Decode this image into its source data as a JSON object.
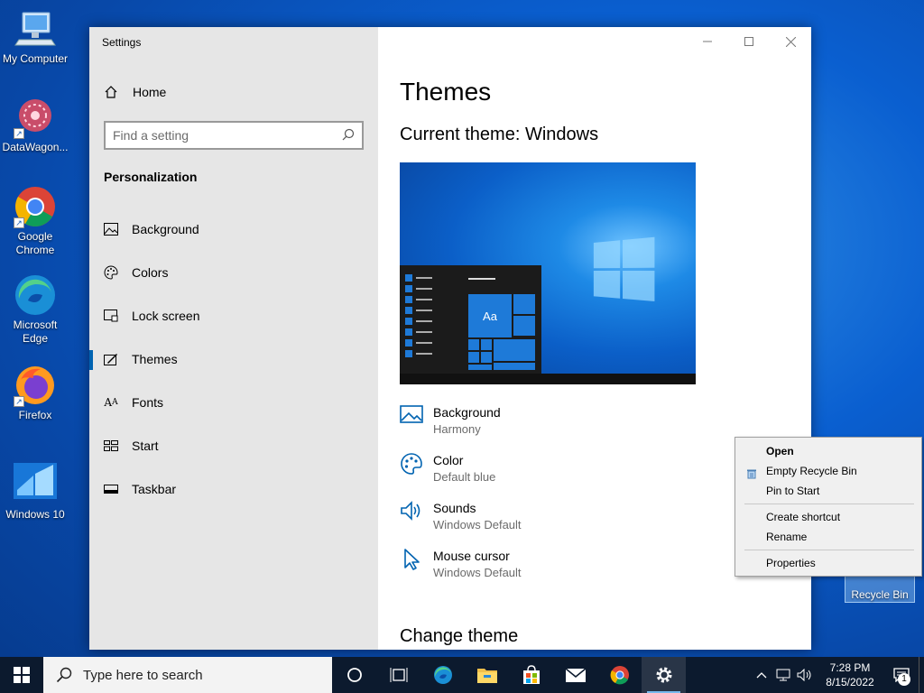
{
  "desktop": {
    "icons": [
      {
        "label": "My Computer"
      },
      {
        "label": "DataWagon..."
      },
      {
        "label": "Google Chrome"
      },
      {
        "label": "Microsoft Edge"
      },
      {
        "label": "Firefox"
      },
      {
        "label": "Windows 10"
      }
    ],
    "recycle_bin": {
      "label": "Recycle Bin"
    }
  },
  "settings": {
    "title": "Settings",
    "home_label": "Home",
    "search_placeholder": "Find a setting",
    "section_title": "Personalization",
    "nav_items": [
      {
        "label": "Background",
        "icon": "image-icon"
      },
      {
        "label": "Colors",
        "icon": "palette-icon"
      },
      {
        "label": "Lock screen",
        "icon": "lock-screen-icon"
      },
      {
        "label": "Themes",
        "icon": "themes-icon",
        "active": true
      },
      {
        "label": "Fonts",
        "icon": "fonts-icon"
      },
      {
        "label": "Start",
        "icon": "start-icon"
      },
      {
        "label": "Taskbar",
        "icon": "taskbar-icon"
      }
    ],
    "page_title": "Themes",
    "current_theme": "Current theme: Windows",
    "preview_tile_text": "Aa",
    "properties": [
      {
        "label": "Background",
        "value": "Harmony",
        "icon": "picture-icon"
      },
      {
        "label": "Color",
        "value": "Default blue",
        "icon": "palette-icon"
      },
      {
        "label": "Sounds",
        "value": "Windows Default",
        "icon": "speaker-icon"
      },
      {
        "label": "Mouse cursor",
        "value": "Windows Default",
        "icon": "cursor-icon"
      }
    ],
    "change_theme": "Change theme"
  },
  "context_menu": {
    "items": [
      {
        "label": "Open",
        "bold": true
      },
      {
        "label": "Empty Recycle Bin",
        "icon": "recycle-bin-icon"
      },
      {
        "label": "Pin to Start"
      },
      {
        "separator": true
      },
      {
        "label": "Create shortcut"
      },
      {
        "label": "Rename"
      },
      {
        "separator": true
      },
      {
        "label": "Properties"
      }
    ]
  },
  "taskbar": {
    "search_placeholder": "Type here to search",
    "time": "7:28 PM",
    "date": "8/15/2022",
    "notification_count": "1",
    "accent_color": "#0063b1"
  }
}
